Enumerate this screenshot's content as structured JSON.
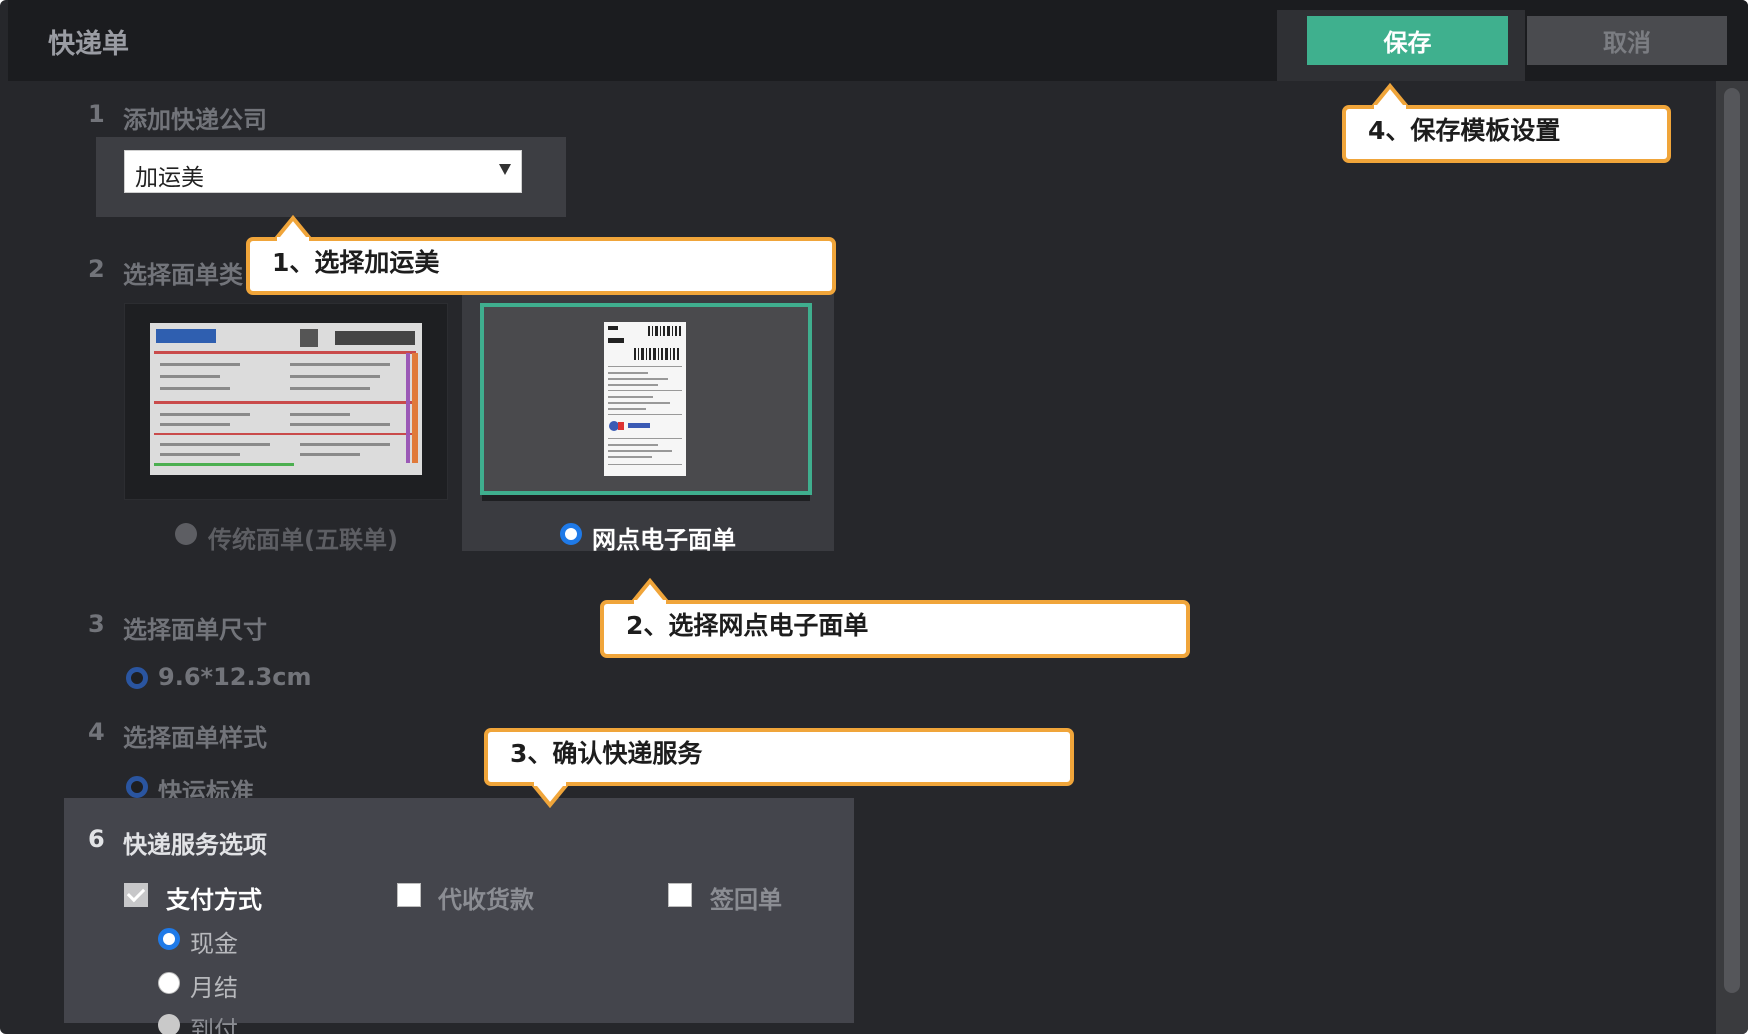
{
  "window": {
    "title": "快递单",
    "save_label": "保存",
    "cancel_label": "取消"
  },
  "steps": {
    "step1": {
      "num": "1",
      "title": "添加快递公司",
      "select_value": "加运美"
    },
    "step2": {
      "num": "2",
      "title": "选择面单类",
      "options": [
        {
          "label": "传统面单(五联单)",
          "selected": false,
          "disabled": true
        },
        {
          "label": "网点电子面单",
          "selected": true,
          "disabled": false
        }
      ]
    },
    "step3": {
      "num": "3",
      "title": "选择面单尺寸",
      "option": "9.6*12.3cm"
    },
    "step4": {
      "num": "4",
      "title": "选择面单样式",
      "option": "快运标准"
    },
    "step6": {
      "num": "6",
      "title": "快递服务选项",
      "checks": [
        {
          "label": "支付方式",
          "checked": true
        },
        {
          "label": "代收货款",
          "checked": false
        },
        {
          "label": "签回单",
          "checked": false
        }
      ],
      "payment_options": [
        {
          "label": "现金",
          "selected": true
        },
        {
          "label": "月结",
          "selected": false
        },
        {
          "label": "到付",
          "selected": false
        }
      ]
    }
  },
  "callouts": [
    {
      "text": "1、选择加运美"
    },
    {
      "text": "2、选择网点电子面单"
    },
    {
      "text": "3、确认快递服务"
    },
    {
      "text": "4、保存模板设置"
    }
  ],
  "colors": {
    "accent": "#3fb08e",
    "callout_border": "#f0a53a",
    "radio_selected": "#1f7ae8"
  }
}
